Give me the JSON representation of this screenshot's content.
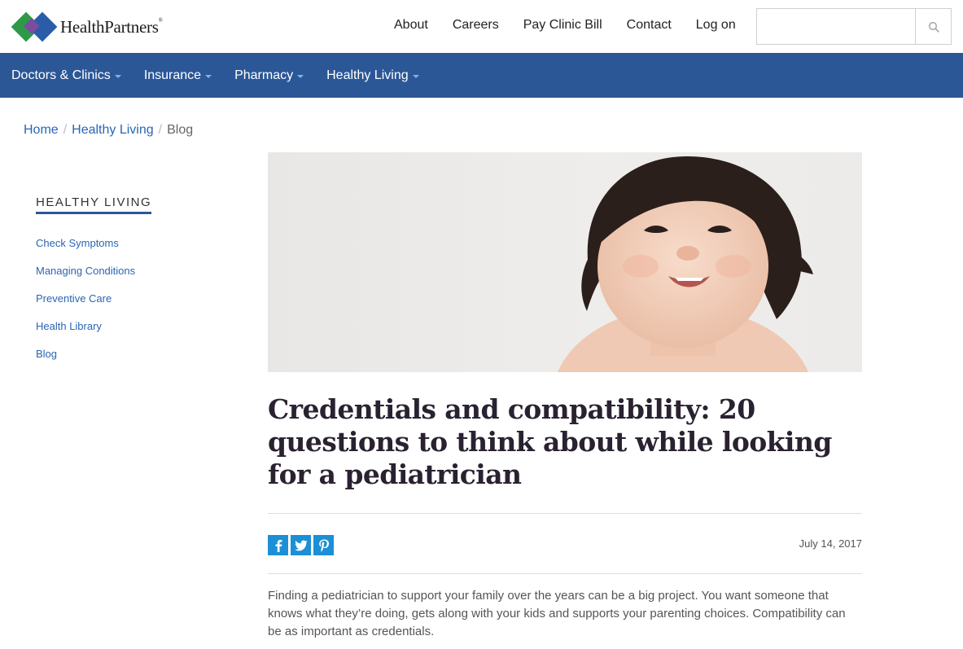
{
  "header": {
    "logo_text": "HealthPartners",
    "utility_links": [
      "About",
      "Careers",
      "Pay Clinic Bill",
      "Contact",
      "Log on"
    ],
    "search": {
      "placeholder": "",
      "value": ""
    }
  },
  "nav": {
    "items": [
      "Doctors & Clinics",
      "Insurance",
      "Pharmacy",
      "Healthy Living"
    ]
  },
  "breadcrumb": {
    "items": [
      "Home",
      "Healthy Living"
    ],
    "current": "Blog"
  },
  "sidebar": {
    "title": "HEALTHY LIVING",
    "items": [
      "Check Symptoms",
      "Managing Conditions",
      "Preventive Care",
      "Health Library",
      "Blog"
    ]
  },
  "article": {
    "title": "Credentials and compatibility: 20 questions to think about while looking for a pediatrician",
    "date": "July 14, 2017",
    "intro": "Finding a pediatrician to support your family over the years can be a big project. You want someone that knows what they’re doing, gets along with your kids and supports your parenting choices. Compatibility can be as important as credentials."
  },
  "colors": {
    "nav_bg": "#2b5797",
    "link": "#2a66b3",
    "share_bg": "#1c8fd6"
  }
}
